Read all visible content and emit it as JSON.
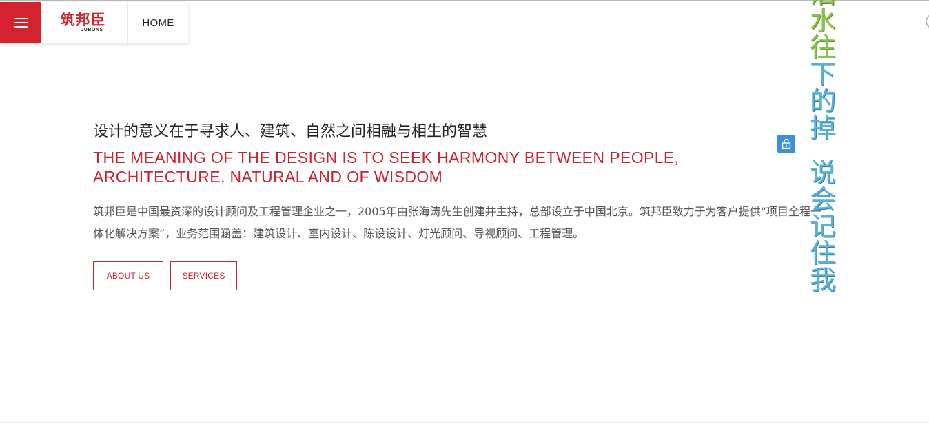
{
  "header": {
    "logo_cn": "筑邦臣",
    "logo_en": "JUBONS",
    "home_label": "HOME"
  },
  "hero": {
    "title_cn": "设计的意义在于寻求人、建筑、自然之间相融与相生的智慧",
    "title_en": "THE MEANING OF THE DESIGN IS TO SEEK HARMONY BETWEEN PEOPLE, ARCHITECTURE, NATURAL AND OF WISDOM",
    "description": "筑邦臣是中国最资深的设计顾问及工程管理企业之一，2005年由张海涛先生创建并主持，总部设立于中国北京。筑邦臣致力于为客户提供“项目全程一体化解决方案”，业务范围涵盖：建筑设计、室内设计、陈设设计、灯光顾问、导视顾问、工程管理。",
    "about_label": "ABOUT US",
    "services_label": "SERVICES"
  },
  "overlay": {
    "vertical_line1": [
      "泪",
      "水",
      "往",
      "下",
      "的",
      "掉"
    ],
    "vertical_line2": [
      "说",
      "会",
      "记",
      "住",
      "我"
    ]
  },
  "colors": {
    "brand_red": "#d5222f",
    "accent_red": "#c9232d",
    "lock_blue": "#3d8fd6"
  },
  "icons": {
    "menu": "hamburger-menu-icon",
    "lock": "unlock-icon"
  }
}
